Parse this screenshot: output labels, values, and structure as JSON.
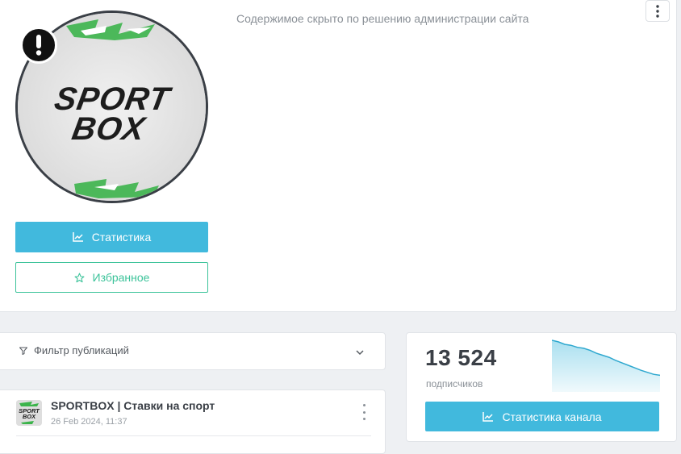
{
  "channel": {
    "hidden_notice": "Содержимое скрыто по решению администрации сайта",
    "logo_text": [
      "SPORT",
      "BOX"
    ],
    "warning_mark": "!"
  },
  "buttons": {
    "statistics": "Статистика",
    "favorites": "Избранное",
    "channel_statistics": "Статистика канала"
  },
  "filter": {
    "label": "Фильтр публикаций"
  },
  "post": {
    "title": "SPORTBOX | Ставки на спорт",
    "date": "26 Feb 2024, 11:37",
    "thumb_text": [
      "SPORT",
      "BOX"
    ]
  },
  "stats": {
    "subscribers": "13 524",
    "subscribers_label": "подписчиков",
    "trend": [
      1.0,
      0.97,
      0.92,
      0.9,
      0.86,
      0.84,
      0.8,
      0.74,
      0.7,
      0.66,
      0.6,
      0.55,
      0.5,
      0.45,
      0.4,
      0.36,
      0.32,
      0.3
    ]
  },
  "colors": {
    "primary": "#41b9dd",
    "success": "#3cc39a",
    "text": "#3a3f46",
    "muted": "#8a9097",
    "logo_green": "#3cb44b"
  },
  "icons": {
    "more": "more-vertical-icon",
    "warning": "exclamation-icon",
    "chart": "line-chart-icon",
    "star": "star-icon",
    "filter": "filter-icon",
    "chevron": "chevron-down-icon"
  }
}
